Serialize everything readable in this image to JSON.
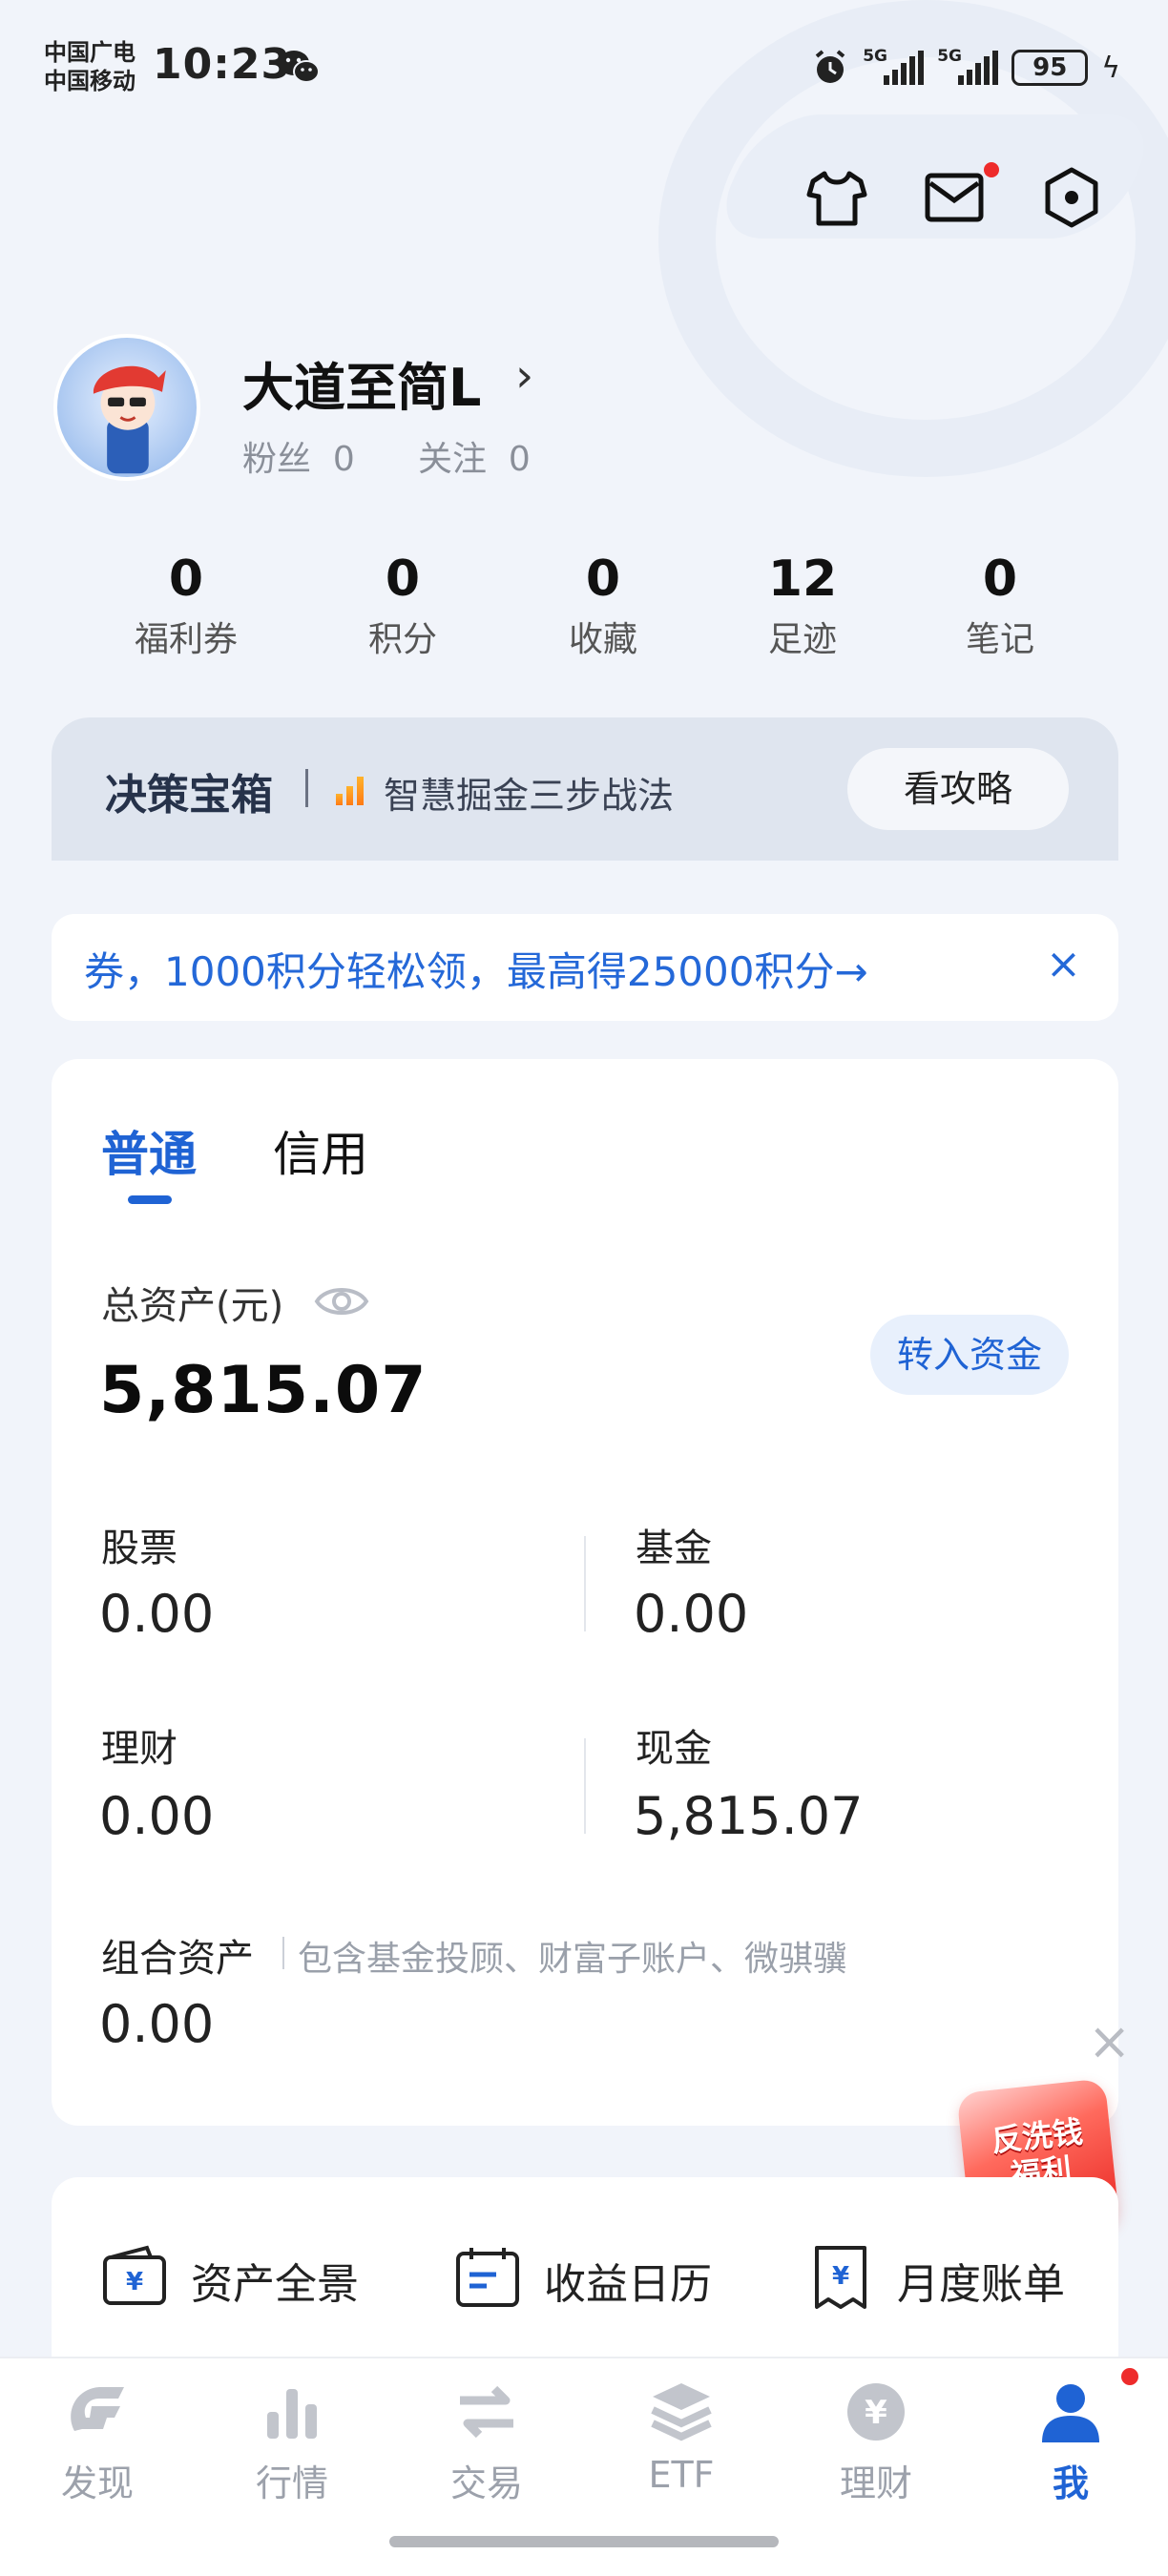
{
  "status_bar": {
    "carrier_1": "中国广电",
    "carrier_2": "中国移动",
    "time": "10:23",
    "signal_1": "5G",
    "signal_2": "5G",
    "battery": "95"
  },
  "profile": {
    "username": "大道至简L",
    "fans_label": "粉丝",
    "fans_count": "0",
    "following_label": "关注",
    "following_count": "0"
  },
  "stats": [
    {
      "value": "0",
      "label": "福利券"
    },
    {
      "value": "0",
      "label": "积分"
    },
    {
      "value": "0",
      "label": "收藏"
    },
    {
      "value": "12",
      "label": "足迹"
    },
    {
      "value": "0",
      "label": "笔记"
    }
  ],
  "decision_box": {
    "title": "决策宝箱",
    "subtitle": "智慧掘金三步战法",
    "button": "看攻略"
  },
  "banner": {
    "text": "券，1000积分轻松领，最高得25000积分→",
    "close": "×"
  },
  "assets": {
    "tabs": [
      "普通",
      "信用"
    ],
    "total_label": "总资产(元)",
    "total_value": "5,815.07",
    "transfer_button": "转入资金",
    "items": [
      {
        "label": "股票",
        "value": "0.00"
      },
      {
        "label": "基金",
        "value": "0.00"
      },
      {
        "label": "理财",
        "value": "0.00"
      },
      {
        "label": "现金",
        "value": "5,815.07"
      }
    ],
    "combo_label": "组合资产",
    "combo_desc": "包含基金投顾、财富子账户、微骐骥",
    "combo_value": "0.00"
  },
  "promo": {
    "line1": "反洗钱",
    "line2": "福利"
  },
  "shortcuts": [
    {
      "label": "资产全景",
      "icon": "wallet-icon"
    },
    {
      "label": "收益日历",
      "icon": "calendar-icon"
    },
    {
      "label": "月度账单",
      "icon": "bill-icon"
    }
  ],
  "bottom_nav": [
    {
      "label": "发现",
      "icon": "discover-icon"
    },
    {
      "label": "行情",
      "icon": "market-icon"
    },
    {
      "label": "交易",
      "icon": "trade-icon"
    },
    {
      "label": "ETF",
      "icon": "etf-icon"
    },
    {
      "label": "理财",
      "icon": "wealth-icon"
    },
    {
      "label": "我",
      "icon": "me-icon",
      "active": true
    }
  ],
  "colors": {
    "accent": "#1f63d4",
    "banner_text": "#2468d8",
    "background": "#f1f4fa",
    "badge": "#ee2b2b"
  }
}
